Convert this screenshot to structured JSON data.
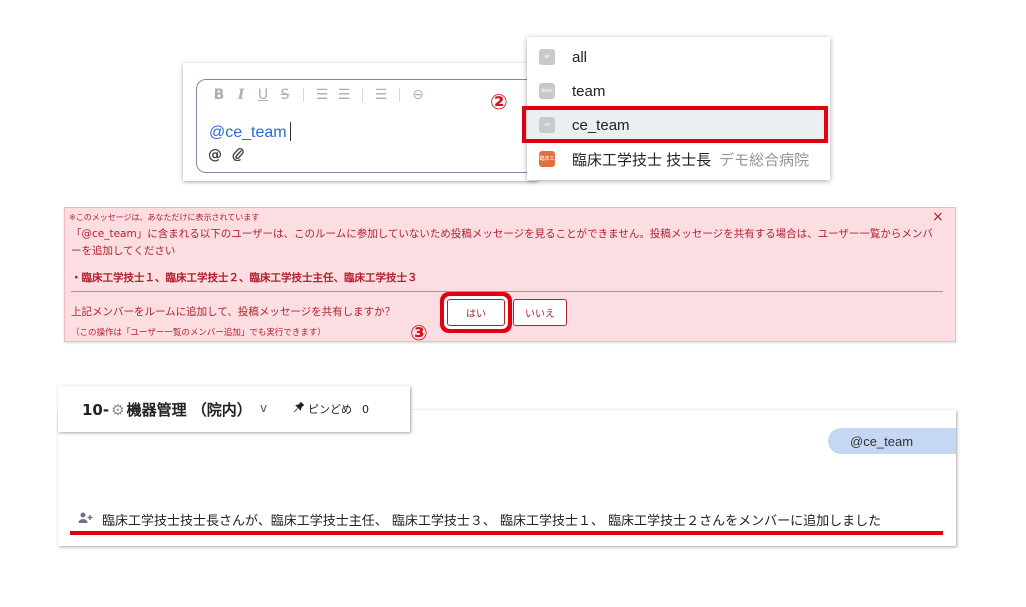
{
  "editor": {
    "toolbar": {
      "bold": "B",
      "italic": "I",
      "underline": "U",
      "strike": "S",
      "bullet_list": "☰",
      "numbered_list": "☰",
      "quote": "☰",
      "link": "⊖"
    },
    "text": "@ce_team",
    "mention_icon": "@",
    "attach_icon": "📎"
  },
  "step_markers": {
    "step2": "②",
    "step3": "③"
  },
  "mention_dropdown": {
    "items": [
      {
        "avatar": "all",
        "label": "all",
        "sub": ""
      },
      {
        "avatar": "team",
        "label": "team",
        "sub": ""
      },
      {
        "avatar": "ce",
        "label": "ce_team",
        "sub": "",
        "selected": true
      },
      {
        "avatar": "臨床工",
        "label": "臨床工学技士 技士長",
        "sub": "デモ総合病院"
      }
    ]
  },
  "notice": {
    "header": "※このメッセージは、あなただけに表示されています",
    "close": "×",
    "body": "「@ce_team」に含まれる以下のユーザーは、このルームに参加していないため投稿メッセージを見ることができません。投稿メッセージを共有する場合は、ユーザー一覧からメンバーを追加してください",
    "members": "・臨床工学技士１、臨床工学技士２、臨床工学技士主任、臨床工学技士３",
    "question": "上記メンバーをルームに追加して、投稿メッセージを共有しますか？",
    "yes": "はい",
    "no": "いいえ",
    "note": "（この操作は「ユーザー一覧のメンバー追加」でも実行できます）"
  },
  "room": {
    "title_prefix": "10-",
    "title_icon": "⚙",
    "title": "機器管理 （院内）",
    "chevron": "v",
    "pin_label": "ピンどめ",
    "pin_count": "0"
  },
  "chat": {
    "bubble": "@ce_team",
    "system_message": "臨床工学技士技士長さんが、臨床工学技士主任、 臨床工学技士３、 臨床工学技士１、 臨床工学技士２さんをメンバーに追加しました"
  },
  "colors": {
    "highlight": "#e1000f",
    "notice_bg": "#fbdde2",
    "notice_text": "#b0222e",
    "bubble": "#c5d7f2"
  }
}
